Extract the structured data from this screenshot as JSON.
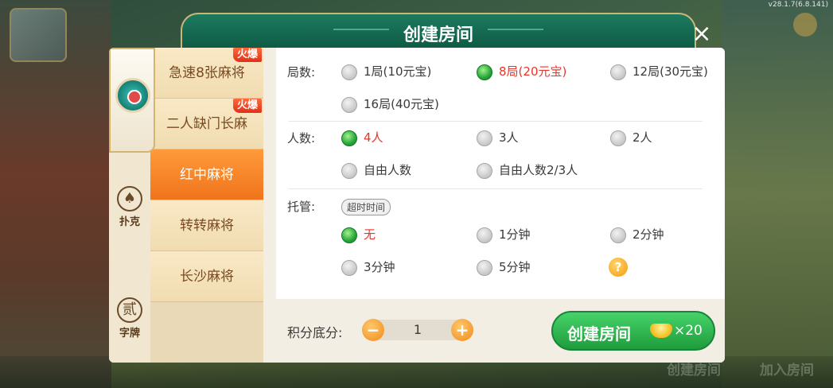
{
  "version": "v28.1.7(6.8.141)",
  "background_bottom": {
    "create_room": "创建房间",
    "join_room": "加入房间"
  },
  "dialog": {
    "title": "创建房间",
    "close_label": "×"
  },
  "categories": [
    {
      "label": "",
      "icon": "mahjong-icon"
    },
    {
      "label": "扑克",
      "icon": "spade-icon"
    },
    {
      "label": "字牌",
      "icon": "zipai-icon"
    }
  ],
  "category_glyphs": {
    "poker": "♠",
    "zipai": "贰"
  },
  "games": [
    {
      "label": "急速8张麻将",
      "hot": "火爆"
    },
    {
      "label": "二人缺门长麻",
      "hot": "火爆"
    },
    {
      "label": "红中麻将",
      "active": true
    },
    {
      "label": "转转麻将"
    },
    {
      "label": "长沙麻将"
    }
  ],
  "rounds": {
    "label": "局数:",
    "options": [
      "1局(10元宝)",
      "8局(20元宝)",
      "12局(30元宝)",
      "16局(40元宝)"
    ],
    "selected": "8局(20元宝)"
  },
  "players": {
    "label": "人数:",
    "options": [
      "4人",
      "3人",
      "2人",
      "自由人数",
      "自由人数2/3人"
    ],
    "selected": "4人"
  },
  "auto": {
    "label": "托管:",
    "tag": "超时时间",
    "options": [
      "无",
      "1分钟",
      "2分钟",
      "3分钟",
      "5分钟"
    ],
    "selected": "无",
    "help": "?"
  },
  "score": {
    "label": "积分底分:",
    "value": "1",
    "minus": "−",
    "plus": "+"
  },
  "create_button": {
    "label": "创建房间",
    "cost": "×20"
  }
}
